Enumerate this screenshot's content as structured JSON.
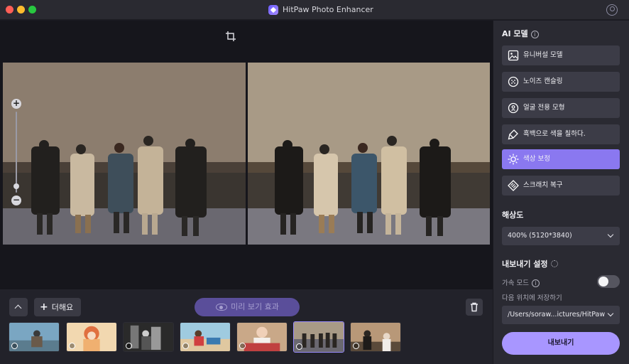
{
  "window": {
    "title": "HitPaw Photo Enhancer"
  },
  "sidebar": {
    "ai_model_title": "AI 모델",
    "models": [
      {
        "label": "유니버설 모델",
        "icon": "image-icon",
        "selected": false
      },
      {
        "label": "노이즈 캔슬링",
        "icon": "noise-icon",
        "selected": false
      },
      {
        "label": "얼굴 전용 모형",
        "icon": "face-icon",
        "selected": false
      },
      {
        "label": "흑백으로 색을 칠하다.",
        "icon": "paint-brush-icon",
        "selected": false
      },
      {
        "label": "색상 보정",
        "icon": "sun-icon",
        "selected": true
      },
      {
        "label": "스크래치 복구",
        "icon": "scratch-repair-icon",
        "selected": false
      }
    ],
    "resolution_title": "해상도",
    "resolution_value": "400% (5120*3840)",
    "export_settings_title": "내보내기 설정",
    "acceleration_label": "가속 모드",
    "acceleration_on": false,
    "save_location_label": "다음 위치에 저장하기",
    "save_path": "/Users/soraw...ictures/HitPaw",
    "export_label": "내보내기"
  },
  "bottom": {
    "add_label": "더해요",
    "preview_label": "미리 보기 효과"
  },
  "thumbnails": [
    {
      "name": "thumb-1",
      "badge": "paint-brush-icon",
      "active": false
    },
    {
      "name": "thumb-2",
      "badge": "face-icon",
      "active": false
    },
    {
      "name": "thumb-3",
      "badge": "sun-icon",
      "active": false
    },
    {
      "name": "thumb-4",
      "badge": "sun-icon",
      "active": false
    },
    {
      "name": "thumb-5",
      "badge": "face-icon",
      "active": false
    },
    {
      "name": "thumb-6",
      "badge": "sun-icon",
      "active": true
    },
    {
      "name": "thumb-7",
      "badge": "face-icon",
      "active": false
    }
  ],
  "colors": {
    "accent": "#8a78f0",
    "export_button": "#a896ff",
    "preview_button": "#5a4e9a"
  }
}
